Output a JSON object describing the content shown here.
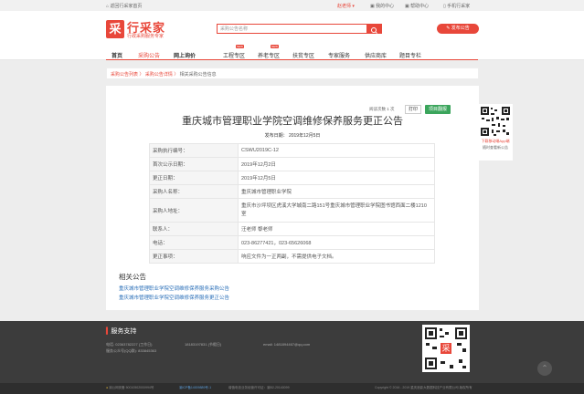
{
  "topbar": {
    "back_home": "返回行采家首页",
    "city": "赵老师",
    "my_center": "我的中心",
    "help_center": "帮助中心",
    "mobile": "手机行采家"
  },
  "header": {
    "logo_char": "采",
    "logo_name": "行采家",
    "slogan": "行政采购服务专家",
    "search_placeholder": "采购公告名称",
    "publish_button": "发布公告"
  },
  "nav": {
    "items": [
      {
        "label": "首页",
        "active": false,
        "new": false
      },
      {
        "label": "采购公告",
        "active": true,
        "new": false
      },
      {
        "label": "网上询价",
        "active": false,
        "new": false
      },
      {
        "label": "工程专区",
        "active": false,
        "new": true
      },
      {
        "label": "养老专区",
        "active": false,
        "new": true
      },
      {
        "label": "扶贫专区",
        "active": false,
        "new": false
      },
      {
        "label": "专家服务",
        "active": false,
        "new": false
      },
      {
        "label": "供应商库",
        "active": false,
        "new": false
      },
      {
        "label": "题目专栏",
        "active": false,
        "new": false
      }
    ],
    "new_tag": "NEW"
  },
  "breadcrumb": {
    "item1": "采购公告列表",
    "sep": "〉",
    "item2": "采购公告详情",
    "item3": "相关采购公告信息"
  },
  "article": {
    "views": "阅读次数 1 次",
    "print_button": "打印",
    "project_button": "项目翻报",
    "title": "重庆城市管理职业学院空调维修保养服务更正公告",
    "publish_date": "发布日期： 2019年12月5日",
    "rows": [
      {
        "key": "采购执行编号：",
        "value": "CSWU2019C-12"
      },
      {
        "key": "首次公示日期：",
        "value": "2019年12月2日"
      },
      {
        "key": "更正日期：",
        "value": "2019年12月5日"
      },
      {
        "key": "采购人名称：",
        "value": "重庆城市管理职业学院"
      },
      {
        "key": "采购人地址：",
        "value": "重庆市沙坪坝区虎溪大学城南二路151号重庆城市管理职业学院图书馆西面二楼1210室"
      },
      {
        "key": "联系人：",
        "value": "汪老师 黎老师"
      },
      {
        "key": "电话：",
        "value": "023-86277421，023-65626068"
      },
      {
        "key": "更正事项：",
        "value": "响应文件为一正两副，不需提供电子文档。"
      }
    ]
  },
  "related": {
    "heading": "相关公告",
    "links": [
      "重庆城市管理职业学院空调维修保养服务采购公告",
      "重庆城市管理职业学院空调维修保养服务更正公告"
    ]
  },
  "qr": {
    "caption1": "下载移动端App端",
    "caption2": "随时查看新公告"
  },
  "footer": {
    "heading": "服务支持",
    "phone": "电话: 02363782227 (工作日)",
    "mobile": "18183197831 (节假日)",
    "email": "email: 1481894467@qq.com",
    "qq": "服务公众号(QQ群): 833845363",
    "bottom_left": "渝公网安备 50010502000994号",
    "icp": "渝ICP备14009889号-1",
    "license": "增值电信业务经营许可证：渝B2-20140099",
    "copyright": "Copyright © 2016 - 2019 重庆浪影大数据科技产业有限公司 版权所有"
  }
}
